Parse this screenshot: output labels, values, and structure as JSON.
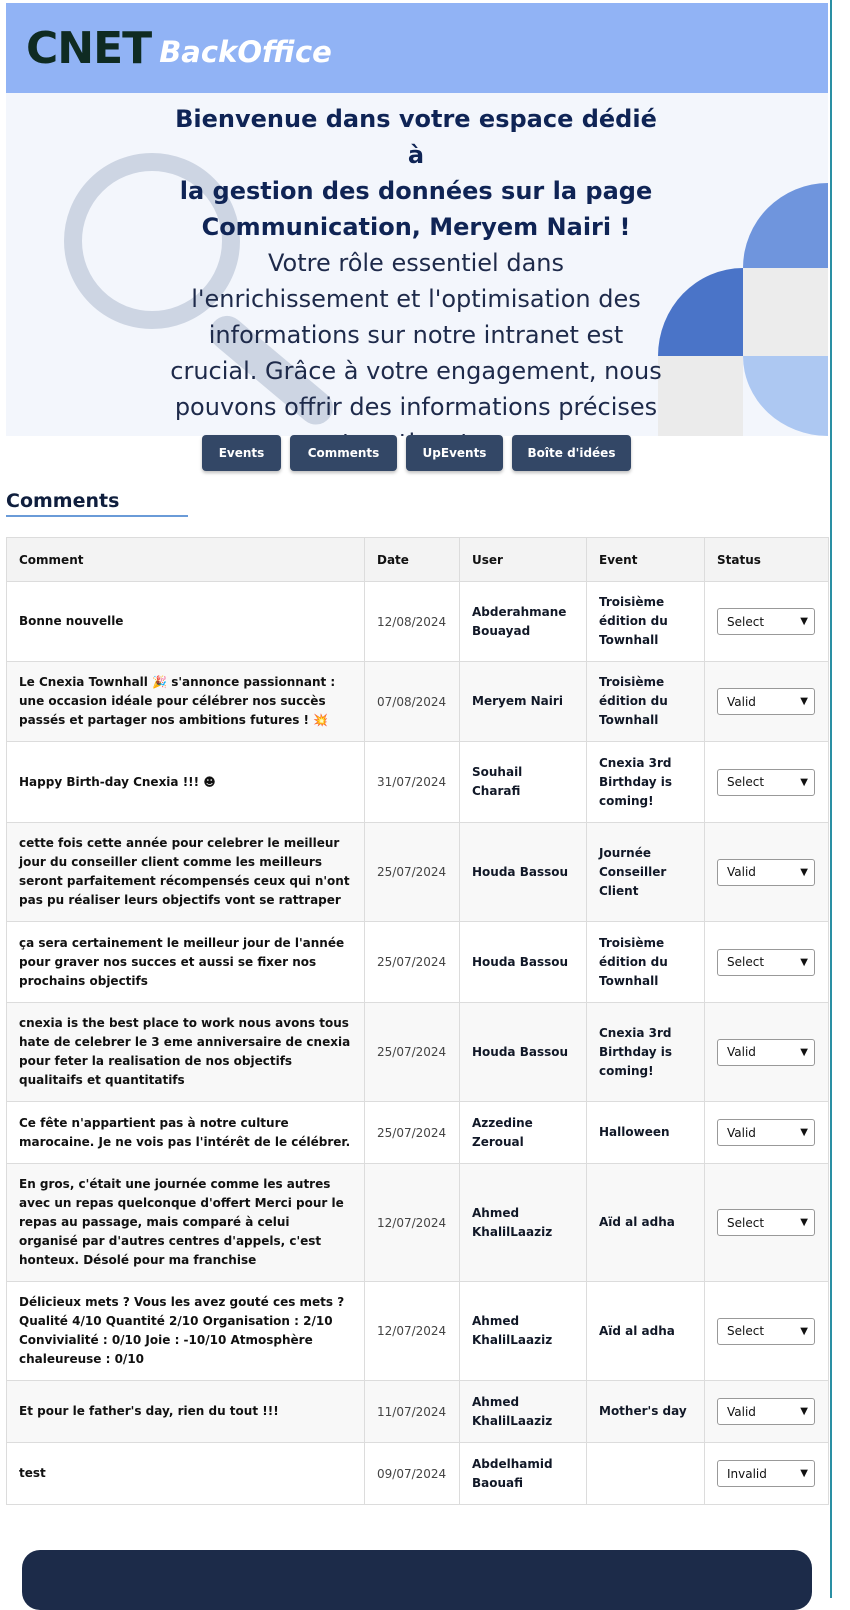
{
  "header": {
    "logo_main": "CNET",
    "logo_sub": "BackOffice",
    "colors": {
      "header_bg": "#91b3f5",
      "accent": "#334766"
    }
  },
  "hero": {
    "title_lines": [
      "Bienvenue dans votre espace dédié à",
      "la gestion des données sur la page",
      "Communication, Meryem Nairi !"
    ],
    "body": "Votre rôle essentiel dans l'enrichissement et l'optimisation des informations sur notre intranet est crucial. Grâce à votre engagement, nous pouvons offrir des informations précises et pertinentes.",
    "icons": {
      "background": "magnifier-icon"
    }
  },
  "nav": {
    "buttons": [
      "Events",
      "Comments",
      "UpEvents",
      "Boîte d'idées"
    ]
  },
  "section": {
    "title": "Comments"
  },
  "table": {
    "headers": [
      "Comment",
      "Date",
      "User",
      "Event",
      "Status"
    ],
    "rows": [
      {
        "comment": "Bonne nouvelle",
        "date": "12/08/2024",
        "user": "Abderahmane Bouayad",
        "event": "Troisième édition du Townhall",
        "status": "Select"
      },
      {
        "comment": "Le Cnexia Townhall 🎉 s'annonce passionnant : une occasion idéale pour célébrer nos succès passés et partager nos ambitions futures ! 💥",
        "date": "07/08/2024",
        "user": "Meryem Nairi",
        "event": "Troisième édition du Townhall",
        "status": "Valid"
      },
      {
        "comment": "Happy Birth-day Cnexia !!! ☻",
        "date": "31/07/2024",
        "user": "Souhail Charafi",
        "event": "Cnexia 3rd Birthday is coming!",
        "status": "Select"
      },
      {
        "comment": "cette fois cette année pour celebrer le meilleur jour du conseiller client comme les meilleurs seront parfaitement récompensés ceux qui n'ont pas pu réaliser leurs objectifs vont se rattraper",
        "date": "25/07/2024",
        "user": "Houda Bassou",
        "event": "Journée Conseiller Client",
        "status": "Valid"
      },
      {
        "comment": "ça sera certainement le meilleur jour de l'année pour graver nos succes et aussi se fixer nos prochains objectifs",
        "date": "25/07/2024",
        "user": "Houda Bassou",
        "event": "Troisième édition du Townhall",
        "status": "Select"
      },
      {
        "comment": "cnexia is the best place to work nous avons tous hate de celebrer le 3 eme anniversaire de cnexia pour feter la realisation de nos objectifs qualitaifs et quantitatifs",
        "date": "25/07/2024",
        "user": "Houda Bassou",
        "event": "Cnexia 3rd Birthday is coming!",
        "status": "Valid"
      },
      {
        "comment": "Ce fête n'appartient pas à notre culture marocaine. Je ne vois pas l'intérêt de le célébrer.",
        "date": "25/07/2024",
        "user": "Azzedine Zeroual",
        "event": "Halloween",
        "status": "Valid"
      },
      {
        "comment": "En gros, c'était une journée comme les autres avec un repas quelconque d'offert Merci pour le repas au passage, mais comparé à celui organisé par d'autres centres d'appels, c'est honteux. Désolé pour ma franchise",
        "date": "12/07/2024",
        "user": "Ahmed KhalilLaaziz",
        "event": "Aïd al adha",
        "status": "Select"
      },
      {
        "comment": "Délicieux mets ? Vous les avez gouté ces mets ? Qualité 4/10 Quantité 2/10 Organisation : 2/10 Convivialité : 0/10 Joie : -10/10 Atmosphère chaleureuse : 0/10",
        "date": "12/07/2024",
        "user": "Ahmed KhalilLaaziz",
        "event": "Aïd al adha",
        "status": "Select"
      },
      {
        "comment": "Et pour le father's day, rien du tout !!!",
        "date": "11/07/2024",
        "user": "Ahmed KhalilLaaziz",
        "event": "Mother's day",
        "status": "Valid"
      },
      {
        "comment": "test",
        "date": "09/07/2024",
        "user": "Abdelhamid Baouafi",
        "event": "",
        "status": "Invalid"
      }
    ]
  }
}
